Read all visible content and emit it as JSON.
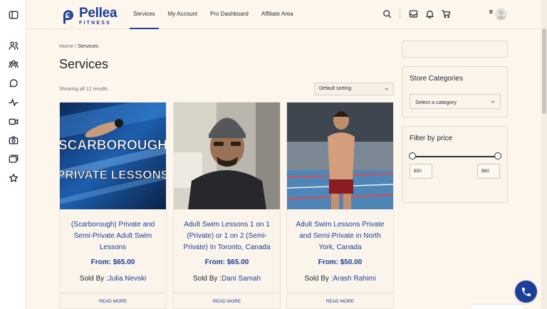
{
  "brand": {
    "name": "Pellea",
    "sub": "FITNESS",
    "color": "#1b3f9a"
  },
  "nav": [
    {
      "label": "Services",
      "active": true
    },
    {
      "label": "My Account",
      "active": false
    },
    {
      "label": "Pro Dashboard",
      "active": false
    },
    {
      "label": "Affiliate Area",
      "active": false
    }
  ],
  "header_icons": [
    "search-icon",
    "inbox-icon",
    "bell-icon",
    "cart-icon"
  ],
  "user": {
    "initial": "B"
  },
  "rail_icons": [
    "panel-toggle-icon",
    "users-icon",
    "groups-icon",
    "chat-icon",
    "activity-icon",
    "video-icon",
    "camera-icon",
    "folders-icon",
    "star-icon"
  ],
  "breadcrumb": {
    "home": "Home",
    "separator": " / ",
    "current": "Services"
  },
  "page": {
    "title": "Services",
    "results": "Showing all 12 results",
    "sorting": "Default sorting"
  },
  "products": [
    {
      "title": "(Scarborough) Private and Semi-Private Adult Swim Lessons",
      "price": "From: $65.00",
      "sold_prefix": "Sold By :",
      "seller": "Julia Nevski",
      "image_text_1": "SCARBOROUGH",
      "image_text_2": "PRIVATE LESSONS",
      "cta": "READ MORE"
    },
    {
      "title": "Adult Swim Lessons 1 on 1 (Private) or 1 on 2 (Semi-Private) In Toronto, Canada",
      "price": "From: $65.00",
      "sold_prefix": "Sold By :",
      "seller": "Dani Samah",
      "cta": "READ MORE"
    },
    {
      "title": "Adult Swim Lessons Private and Semi-Private in North York, Canada",
      "price": "From: $50.00",
      "sold_prefix": "Sold By :",
      "seller": "Arash Rahimi",
      "cta": "READ MORE"
    }
  ],
  "sidebar": {
    "categories": {
      "title": "Store Categories",
      "placeholder": "Select a category"
    },
    "price_filter": {
      "title": "Filter by price",
      "min": "$50",
      "max": "$80"
    }
  }
}
